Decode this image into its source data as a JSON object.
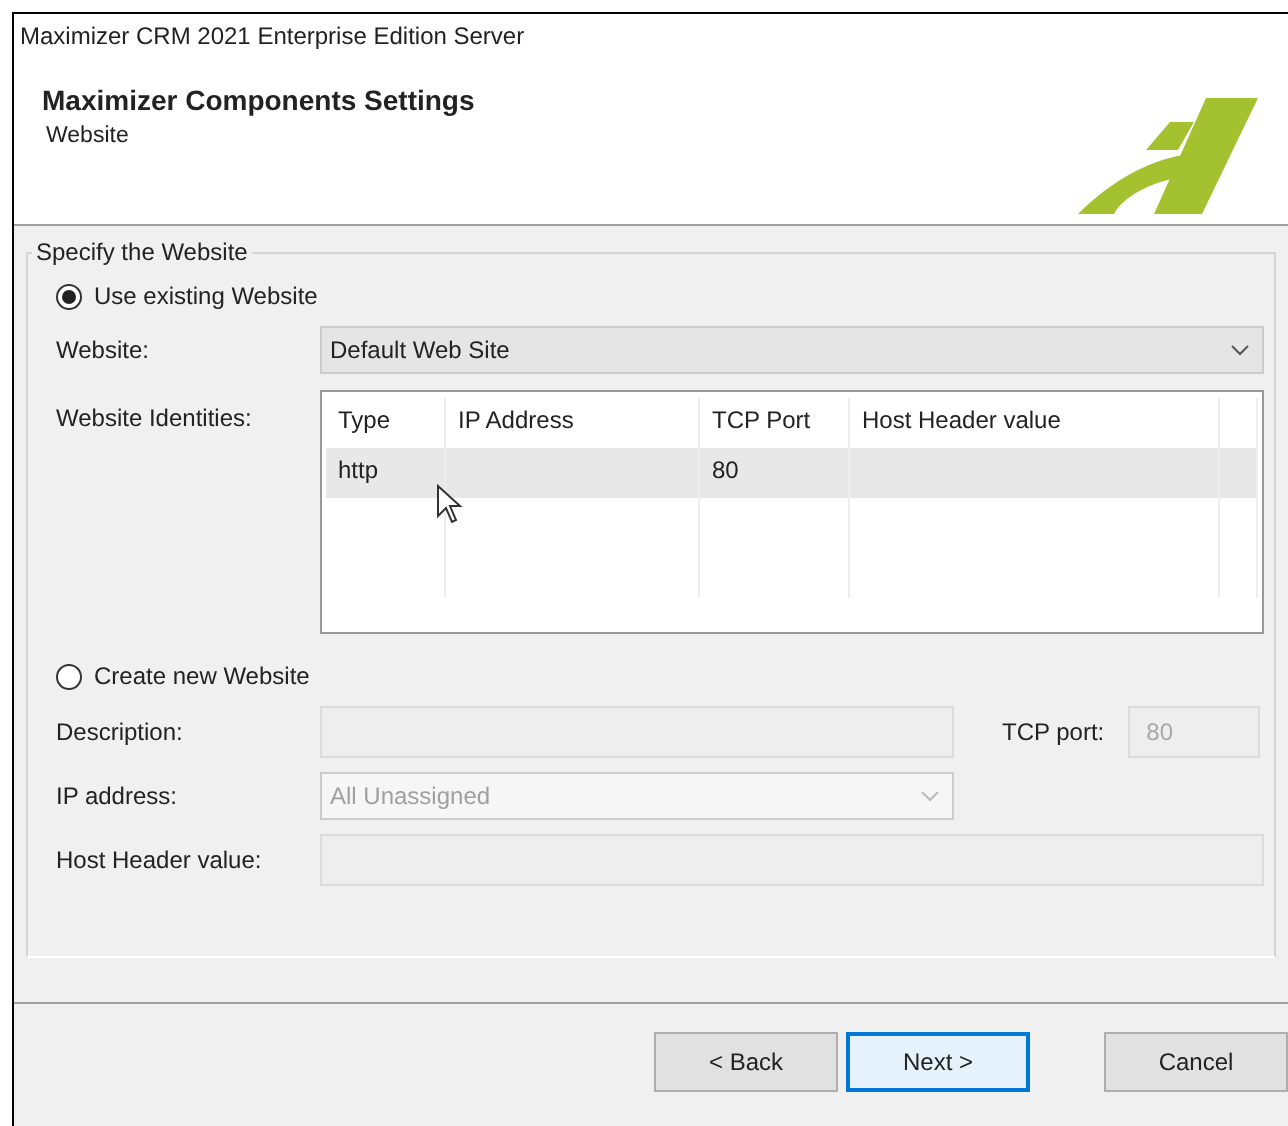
{
  "window": {
    "title": "Maximizer CRM 2021 Enterprise Edition Server"
  },
  "header": {
    "title": "Maximizer Components Settings",
    "subtitle": "Website"
  },
  "group": {
    "title": "Specify the Website"
  },
  "existing": {
    "radio": {
      "label": "Use existing Website",
      "selected": true
    },
    "website": {
      "label": "Website:",
      "value": "Default Web Site"
    },
    "identities": {
      "label": "Website Identities:",
      "columns": [
        "Type",
        "IP Address",
        "TCP Port",
        "Host Header value"
      ],
      "rows": [
        {
          "cells": [
            "http",
            "",
            "80",
            ""
          ],
          "selected": true
        }
      ]
    }
  },
  "create_new": {
    "radio": {
      "label": "Create new Website",
      "selected": false
    },
    "disabled": true,
    "description": {
      "label": "Description:"
    },
    "tcp_port": {
      "label": "TCP port:",
      "value": "80"
    },
    "ip_address": {
      "label": "IP address:",
      "value": "All Unassigned"
    },
    "host_header": {
      "label": "Host Header value:"
    }
  },
  "buttons": [
    {
      "label": "< Back",
      "focused": false
    },
    {
      "label": "Next >",
      "focused": true
    },
    {
      "label": "Cancel",
      "focused": false
    }
  ]
}
